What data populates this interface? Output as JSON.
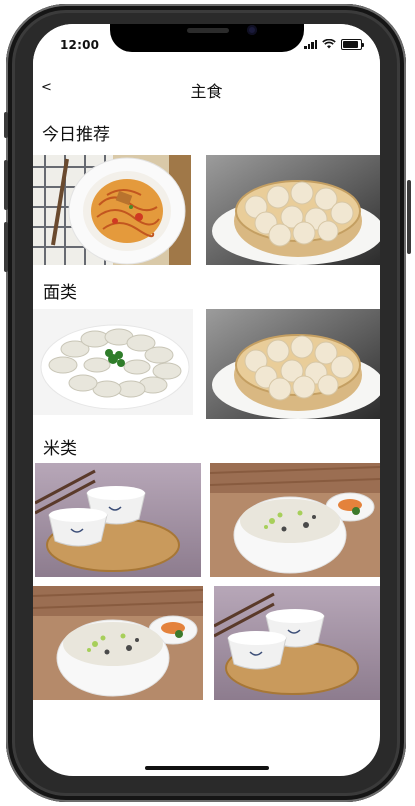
{
  "status_bar": {
    "time": "12:00"
  },
  "nav": {
    "back_label": "<",
    "title": "主食"
  },
  "sections": [
    {
      "title": "今日推荐",
      "items": [
        {
          "name": "spaghetti"
        },
        {
          "name": "soup-dumplings"
        }
      ]
    },
    {
      "title": "面类",
      "items": [
        {
          "name": "dumplings"
        },
        {
          "name": "soup-dumplings"
        }
      ]
    },
    {
      "title": "米类",
      "items": [
        {
          "name": "rice-bowls"
        },
        {
          "name": "congee"
        },
        {
          "name": "congee"
        },
        {
          "name": "rice-bowls"
        }
      ]
    }
  ],
  "colors": {
    "phone_frame": "#2a2a2a",
    "screen_bg": "#ffffff",
    "text": "#111111"
  }
}
